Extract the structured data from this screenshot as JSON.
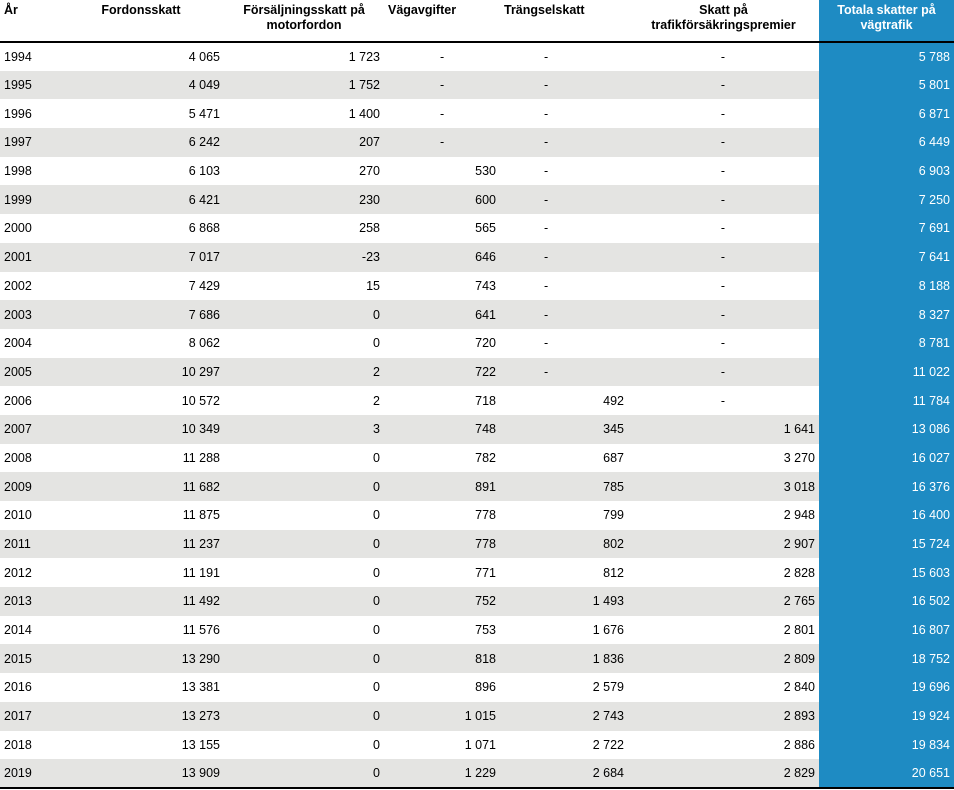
{
  "headers": {
    "year": "År",
    "vehicle_tax": "Fordonsskatt",
    "sales_tax": "Försäljningsskatt på motorfordon",
    "road_charges": "Vägavgifter",
    "congestion_tax": "Trängselskatt",
    "insurance_tax": "Skatt på trafikförsäkringspremier",
    "total": "Totala skatter på vägtrafik"
  },
  "rows": [
    [
      "1994",
      "4 065",
      "1 723",
      "-",
      "-",
      "-",
      "5 788"
    ],
    [
      "1995",
      "4 049",
      "1 752",
      "-",
      "-",
      "-",
      "5 801"
    ],
    [
      "1996",
      "5 471",
      "1 400",
      "-",
      "-",
      "-",
      "6 871"
    ],
    [
      "1997",
      "6 242",
      "207",
      "-",
      "-",
      "-",
      "6 449"
    ],
    [
      "1998",
      "6 103",
      "270",
      "530",
      "-",
      "-",
      "6 903"
    ],
    [
      "1999",
      "6 421",
      "230",
      "600",
      "-",
      "-",
      "7 250"
    ],
    [
      "2000",
      "6 868",
      "258",
      "565",
      "-",
      "-",
      "7 691"
    ],
    [
      "2001",
      "7 017",
      "-23",
      "646",
      "-",
      "-",
      "7 641"
    ],
    [
      "2002",
      "7 429",
      "15",
      "743",
      "-",
      "-",
      "8 188"
    ],
    [
      "2003",
      "7 686",
      "0",
      "641",
      "-",
      "-",
      "8 327"
    ],
    [
      "2004",
      "8 062",
      "0",
      "720",
      "-",
      "-",
      "8 781"
    ],
    [
      "2005",
      "10 297",
      "2",
      "722",
      "-",
      "-",
      "11 022"
    ],
    [
      "2006",
      "10 572",
      "2",
      "718",
      "492",
      "-",
      "11 784"
    ],
    [
      "2007",
      "10 349",
      "3",
      "748",
      "345",
      "1 641",
      "13 086"
    ],
    [
      "2008",
      "11 288",
      "0",
      "782",
      "687",
      "3 270",
      "16 027"
    ],
    [
      "2009",
      "11 682",
      "0",
      "891",
      "785",
      "3 018",
      "16 376"
    ],
    [
      "2010",
      "11 875",
      "0",
      "778",
      "799",
      "2 948",
      "16 400"
    ],
    [
      "2011",
      "11 237",
      "0",
      "778",
      "802",
      "2 907",
      "15 724"
    ],
    [
      "2012",
      "11 191",
      "0",
      "771",
      "812",
      "2 828",
      "15 603"
    ],
    [
      "2013",
      "11 492",
      "0",
      "752",
      "1 493",
      "2 765",
      "16 502"
    ],
    [
      "2014",
      "11 576",
      "0",
      "753",
      "1 676",
      "2 801",
      "16 807"
    ],
    [
      "2015",
      "13 290",
      "0",
      "818",
      "1 836",
      "2 809",
      "18 752"
    ],
    [
      "2016",
      "13 381",
      "0",
      "896",
      "2 579",
      "2 840",
      "19 696"
    ],
    [
      "2017",
      "13 273",
      "0",
      "1 015",
      "2 743",
      "2 893",
      "19 924"
    ],
    [
      "2018",
      "13 155",
      "0",
      "1 071",
      "2 722",
      "2 886",
      "19 834"
    ],
    [
      "2019",
      "13 909",
      "0",
      "1 229",
      "2 684",
      "2 829",
      "20 651"
    ]
  ],
  "colors": {
    "total_column": "#1e8bc3",
    "stripe": "#e4e4e2"
  }
}
